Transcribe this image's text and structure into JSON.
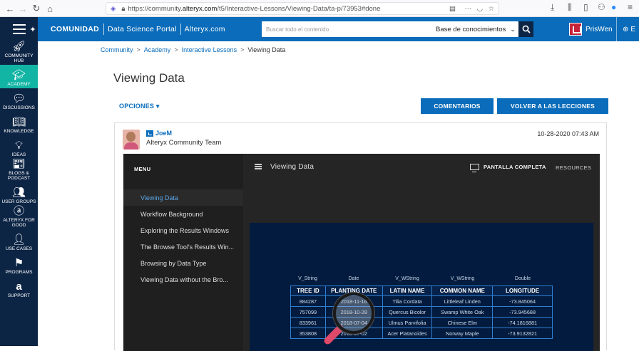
{
  "browser": {
    "url_prefix": "https://community.",
    "url_domain": "alteryx.com",
    "url_path": "/t5/Interactive-Lessons/Viewing-Data/ta-p/73953#done"
  },
  "topbar": {
    "brand": "COMUNIDAD",
    "links": [
      "Data Science Portal",
      "Alteryx.com"
    ],
    "search_placeholder": "Buscar todo el contenido",
    "search_scope": "Base de conocimientos",
    "user_name": "PrisWen",
    "lang": "E"
  },
  "sidebar": {
    "items": [
      {
        "label": "COMMUNITY HUB",
        "icon": "rocket-icon"
      },
      {
        "label": "ACADEMY",
        "icon": "graduation-cap-icon",
        "active": true
      },
      {
        "label": "DISCUSSIONS",
        "icon": "chat-bubbles-icon"
      },
      {
        "label": "KNOWLEDGE",
        "icon": "book-icon"
      },
      {
        "label": "IDEAS",
        "icon": "lightbulb-icon"
      },
      {
        "label": "BLOGS & PODCAST",
        "icon": "newspaper-icon"
      },
      {
        "label": "USER GROUPS",
        "icon": "users-icon"
      },
      {
        "label": "ALTERYX FOR GOOD",
        "icon": "alteryx-good-icon"
      },
      {
        "label": "USE CASES",
        "icon": "person-gear-icon"
      },
      {
        "label": "PROGRAMS",
        "icon": "flag-icon"
      },
      {
        "label": "SUPPORT",
        "icon": "alteryx-a-icon"
      }
    ]
  },
  "breadcrumb": {
    "items": [
      "Community",
      "Academy",
      "Interactive Lessons"
    ],
    "current": "Viewing Data"
  },
  "page": {
    "title": "Viewing Data",
    "options_label": "OPCIONES",
    "comments_button": "COMENTARIOS",
    "back_button": "VOLVER A LAS LECCIONES"
  },
  "post": {
    "author": "JoeM",
    "role": "Alteryx Community Team",
    "date": "10-28-2020 07:43 AM"
  },
  "player": {
    "menu_label": "MENU",
    "title": "Viewing Data",
    "fullscreen_label": "PANTALLA COMPLETA",
    "resources_label": "RESOURCES",
    "menu_items": [
      {
        "label": "Viewing Data",
        "active": true
      },
      {
        "label": "Workflow Background"
      },
      {
        "label": "Exploring the Results Windows"
      },
      {
        "label": "The Browse Tool's Results Win..."
      },
      {
        "label": "Browsing by Data Type"
      },
      {
        "label": "Viewing Data without the Bro..."
      }
    ]
  },
  "table": {
    "types": [
      "V_String",
      "Date",
      "V_WString",
      "V_WString",
      "Double"
    ],
    "headers": [
      "TREE ID",
      "PLANTING DATE",
      "LATIN NAME",
      "COMMON NAME",
      "LONGITUDE"
    ],
    "rows": [
      [
        "884287",
        "2018-11-16",
        "Tilia Cordata",
        "Littleleaf Linden",
        "-73.845064"
      ],
      [
        "757099",
        "2018-10-28",
        "Quercus Bicolor",
        "Swamp White Oak",
        "-73.945688"
      ],
      [
        "833961",
        "2018-07-04",
        "Ulmus Parvifolia",
        "Chinese Elm",
        "-74.1816881"
      ],
      [
        "353808",
        "2018-07-02",
        "Acer Platanoides",
        "Norway Maple",
        "-73.9132821"
      ]
    ]
  }
}
